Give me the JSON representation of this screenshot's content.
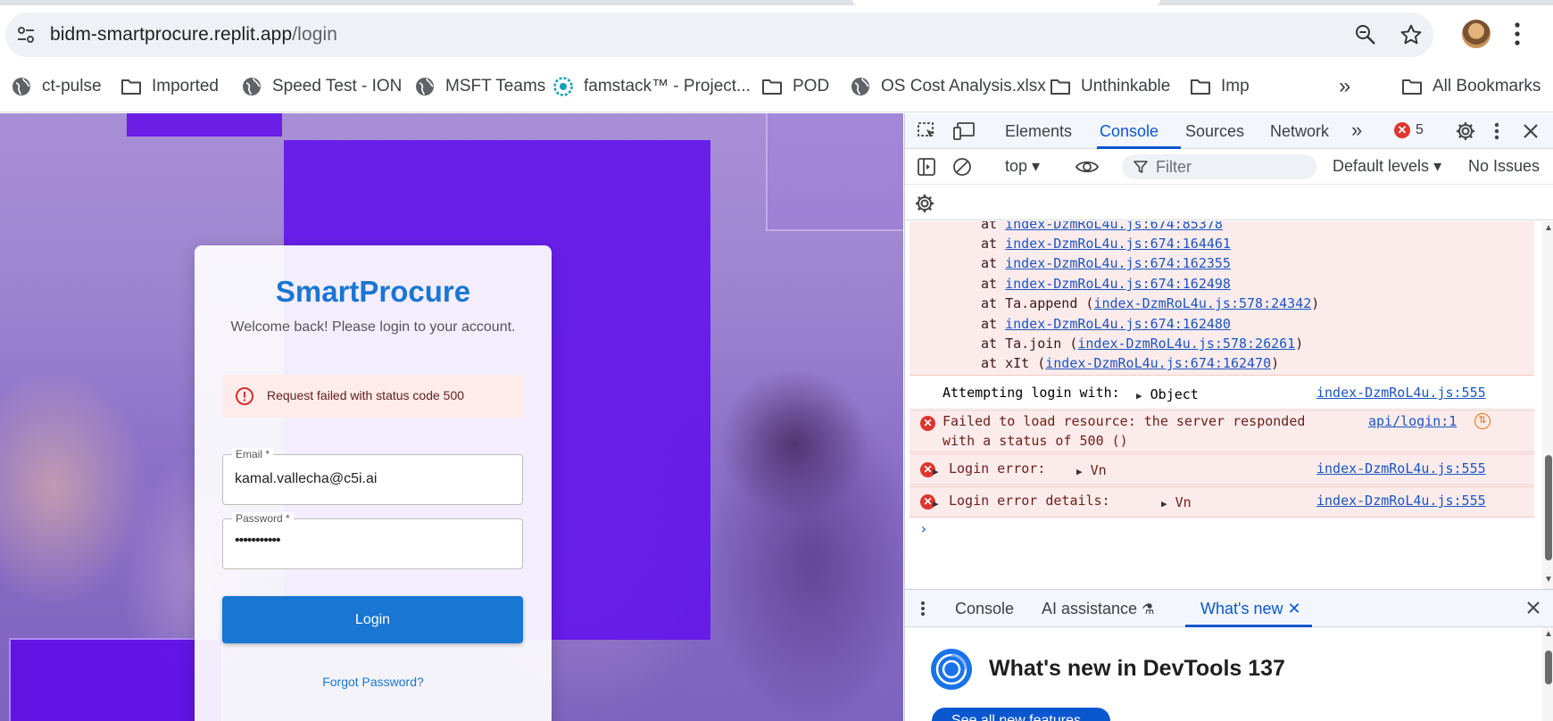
{
  "browser": {
    "url_host": "bidm-smartprocure.replit.app",
    "url_path": "/login",
    "bookmarks": [
      {
        "label": "ct-pulse",
        "icon": "globe-icon"
      },
      {
        "label": "Imported",
        "icon": "folder-icon"
      },
      {
        "label": "Speed Test - ION",
        "icon": "globe-icon"
      },
      {
        "label": "MSFT Teams",
        "icon": "globe-icon"
      },
      {
        "label": "famstack™ - Project...",
        "icon": "famstack-icon"
      },
      {
        "label": "POD",
        "icon": "folder-icon"
      },
      {
        "label": "OS Cost Analysis.xlsx",
        "icon": "globe-icon"
      },
      {
        "label": "Unthinkable",
        "icon": "folder-icon"
      },
      {
        "label": "Imp",
        "icon": "folder-icon"
      }
    ],
    "more_bookmarks": "»",
    "all_bookmarks": "All Bookmarks"
  },
  "login": {
    "title": "SmartProcure",
    "subtitle": "Welcome back! Please login to your account.",
    "error": "Request failed with status code 500",
    "email_label": "Email *",
    "email_value": "kamal.vallecha@c5i.ai",
    "password_label": "Password *",
    "password_value": "•••••••••••",
    "login_button": "Login",
    "forgot_link": "Forgot Password?"
  },
  "devtools": {
    "tabs": [
      "Elements",
      "Console",
      "Sources",
      "Network"
    ],
    "active_tab": "Console",
    "more_tabs": "»",
    "error_count": "5",
    "context": "top",
    "filter_placeholder": "Filter",
    "levels": "Default levels",
    "issues": "No Issues",
    "stack": [
      {
        "prefix": "at ",
        "fn": "",
        "link": "index-DzmRoL4u.js:674:85378",
        "suffix": ""
      },
      {
        "prefix": "at ",
        "fn": "",
        "link": "index-DzmRoL4u.js:674:164461",
        "suffix": ""
      },
      {
        "prefix": "at ",
        "fn": "",
        "link": "index-DzmRoL4u.js:674:162355",
        "suffix": ""
      },
      {
        "prefix": "at ",
        "fn": "",
        "link": "index-DzmRoL4u.js:674:162498",
        "suffix": ""
      },
      {
        "prefix": "at ",
        "fn": "Ta.append (",
        "link": "index-DzmRoL4u.js:578:24342",
        "suffix": ")"
      },
      {
        "prefix": "at ",
        "fn": "",
        "link": "index-DzmRoL4u.js:674:162480",
        "suffix": ""
      },
      {
        "prefix": "at ",
        "fn": "Ta.join (",
        "link": "index-DzmRoL4u.js:578:26261",
        "suffix": ")"
      },
      {
        "prefix": "at ",
        "fn": "xIt (",
        "link": "index-DzmRoL4u.js:674:162470",
        "suffix": ")"
      }
    ],
    "log_attempt": "Attempting login with:",
    "log_attempt_obj": "Object",
    "log_attempt_src": "index-DzmRoL4u.js:555",
    "log_fail_1": "Failed to load resource: the server responded",
    "log_fail_2": "with a status of 500 ()",
    "log_fail_src": "api/login:1",
    "log_err1": "Login error:",
    "log_err1_obj": "Vn",
    "log_err1_src": "index-DzmRoL4u.js:555",
    "log_err2": "Login error details:",
    "log_err2_obj": "Vn",
    "log_err2_src": "index-DzmRoL4u.js:555",
    "prompt": "›",
    "drawer_tabs": [
      "Console",
      "AI assistance",
      "What's new"
    ],
    "whats_new_title": "What's new in DevTools 137",
    "whats_new_button": "See all new features"
  }
}
